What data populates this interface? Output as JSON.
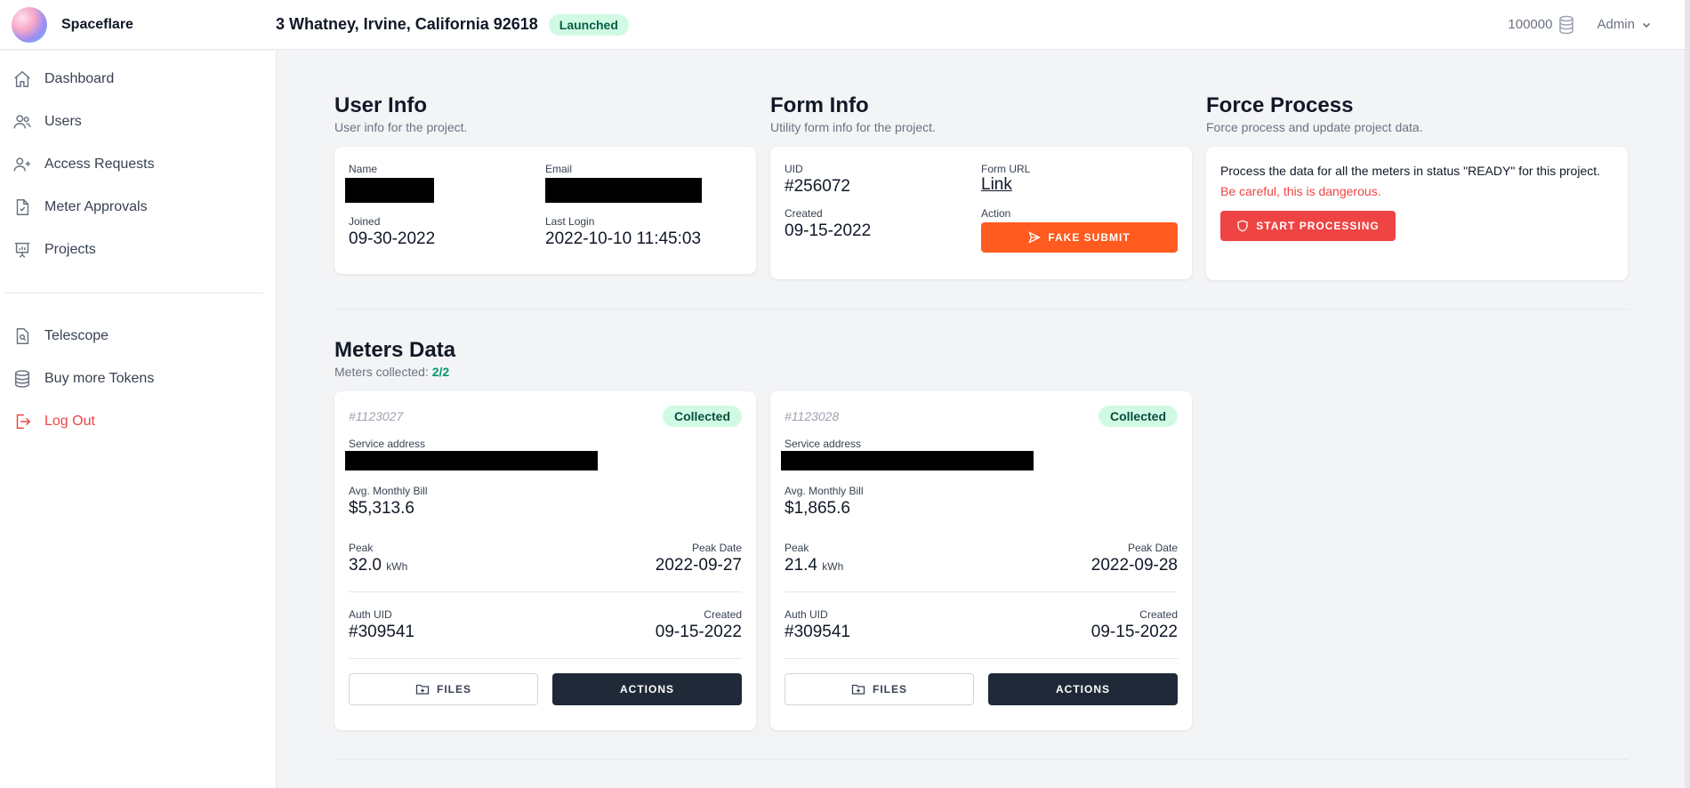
{
  "app": {
    "name": "Spaceflare"
  },
  "header": {
    "project_address": "3 Whatney, Irvine, California 92618",
    "status_badge": "Launched",
    "tokens": "100000",
    "user_menu": "Admin"
  },
  "sidebar": {
    "items": [
      {
        "label": "Dashboard",
        "icon": "home-icon"
      },
      {
        "label": "Users",
        "icon": "users-icon"
      },
      {
        "label": "Access Requests",
        "icon": "user-plus-icon"
      },
      {
        "label": "Meter Approvals",
        "icon": "document-check-icon"
      },
      {
        "label": "Projects",
        "icon": "presentation-chart-icon"
      }
    ],
    "secondary": [
      {
        "label": "Telescope",
        "icon": "document-search-icon"
      },
      {
        "label": "Buy more Tokens",
        "icon": "database-icon"
      },
      {
        "label": "Log Out",
        "icon": "logout-icon"
      }
    ]
  },
  "user_info": {
    "title": "User Info",
    "subtitle": "User info for the project.",
    "name_label": "Name",
    "email_label": "Email",
    "joined_label": "Joined",
    "joined": "09-30-2022",
    "last_login_label": "Last Login",
    "last_login": "2022-10-10 11:45:03"
  },
  "form_info": {
    "title": "Form Info",
    "subtitle": "Utility form info for the project.",
    "uid_label": "UID",
    "uid": "#256072",
    "form_url_label": "Form URL",
    "form_url_text": "Link",
    "created_label": "Created",
    "created": "09-15-2022",
    "action_label": "Action",
    "action_button": "FAKE SUBMIT"
  },
  "force_process": {
    "title": "Force Process",
    "subtitle": "Force process and update project data.",
    "description": "Process the data for all the meters in status \"READY\" for this project.",
    "warning": "Be careful, this is dangerous.",
    "button": "START PROCESSING"
  },
  "meters": {
    "title": "Meters Data",
    "collected_label": "Meters collected:",
    "collected_value": "2/2",
    "cards": [
      {
        "id": "#1123027",
        "status": "Collected",
        "service_address_label": "Service address",
        "avg_bill_label": "Avg. Monthly Bill",
        "avg_bill": "$5,313.6",
        "peak_label": "Peak",
        "peak": "32.0",
        "peak_unit": "kWh",
        "peak_date_label": "Peak Date",
        "peak_date": "2022-09-27",
        "auth_uid_label": "Auth UID",
        "auth_uid": "#309541",
        "created_label": "Created",
        "created": "09-15-2022",
        "files_button": "FILES",
        "actions_button": "ACTIONS"
      },
      {
        "id": "#1123028",
        "status": "Collected",
        "service_address_label": "Service address",
        "avg_bill_label": "Avg. Monthly Bill",
        "avg_bill": "$1,865.6",
        "peak_label": "Peak",
        "peak": "21.4",
        "peak_unit": "kWh",
        "peak_date_label": "Peak Date",
        "peak_date": "2022-09-28",
        "auth_uid_label": "Auth UID",
        "auth_uid": "#309541",
        "created_label": "Created",
        "created": "09-15-2022",
        "files_button": "FILES",
        "actions_button": "ACTIONS"
      }
    ]
  },
  "colors": {
    "accent_orange": "#ff5a1f",
    "danger_red": "#ef4444",
    "success_green": "#059669",
    "dark_button": "#1f2937"
  }
}
